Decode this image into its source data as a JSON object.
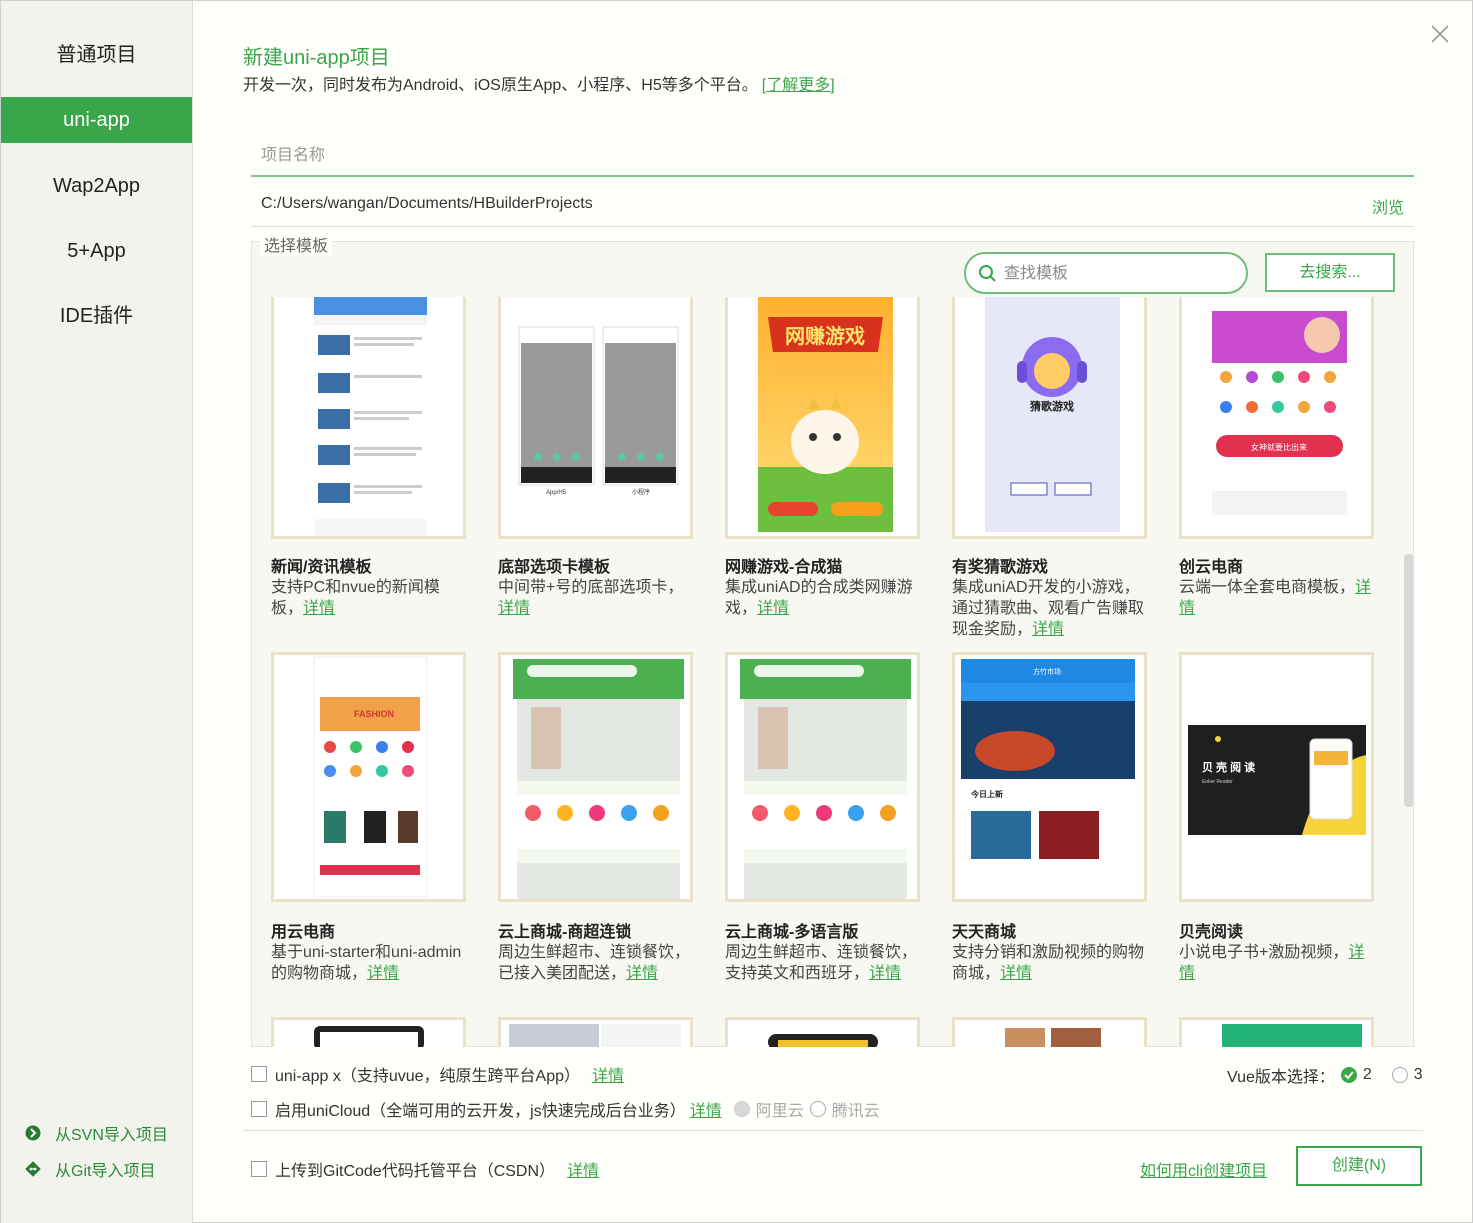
{
  "sidebar": {
    "items": [
      {
        "label": "普通项目"
      },
      {
        "label": "uni-app"
      },
      {
        "label": "Wap2App"
      },
      {
        "label": "5+App"
      },
      {
        "label": "IDE插件"
      }
    ],
    "svn_import": "从SVN导入项目",
    "git_import": "从Git导入项目"
  },
  "header": {
    "title": "新建uni-app项目",
    "subtitle": "开发一次，同时发布为Android、iOS原生App、小程序、H5等多个平台。",
    "learn_more": "[了解更多]"
  },
  "form": {
    "name_placeholder": "项目名称",
    "path": "C:/Users/wangan/Documents/HBuilderProjects",
    "browse": "浏览"
  },
  "templates": {
    "legend": "选择模板",
    "search_placeholder": "查找模板",
    "search_button": "去搜索...",
    "detail_link": "详情",
    "cards": [
      {
        "title": "新闻/资讯模板",
        "desc": "支持PC和nvue的新闻模板，"
      },
      {
        "title": "底部选项卡模板",
        "desc": "中间带+号的底部选项卡，"
      },
      {
        "title": "网赚游戏-合成猫",
        "desc": "集成uniAD的合成类网赚游戏，"
      },
      {
        "title": "有奖猜歌游戏",
        "desc": "集成uniAD开发的小游戏，通过猜歌曲、观看广告赚取现金奖励，"
      },
      {
        "title": "创云电商",
        "desc": "云端一体全套电商模板，"
      },
      {
        "title": "用云电商",
        "desc": "基于uni-starter和uni-admin的购物商城，"
      },
      {
        "title": "云上商城-商超连锁",
        "desc": "周边生鲜超市、连锁餐饮，已接入美团配送，"
      },
      {
        "title": "云上商城-多语言版",
        "desc": "周边生鲜超市、连锁餐饮，支持英文和西班牙，"
      },
      {
        "title": "天天商城",
        "desc": "支持分销和激励视频的购物商城，"
      },
      {
        "title": "贝壳阅读",
        "desc": "小说电子书+激励视频，"
      }
    ],
    "thumb_text": {
      "game_title": "网赚游戏",
      "guess_title": "猜歌游戏",
      "reader_title": "贝 壳 阅 读",
      "reader_sub": "Enker Reader",
      "shop_sale": "女神就要比出来",
      "tt_market": "方竹市场",
      "tt_new": "今日上新",
      "fashion": "FASHION",
      "app_h5": "App/H5",
      "mini": "小程序"
    }
  },
  "options": {
    "unix_label": "uni-app x（支持uvue，纯原生跨平台App）",
    "unicloud_label": "启用uniCloud（全端可用的云开发，js快速完成后台业务）",
    "aliyun": "阿里云",
    "tencent": "腾讯云",
    "vue_label": "Vue版本选择：",
    "vue2": "2",
    "vue3": "3",
    "gitcode_label": "上传到GitCode代码托管平台（CSDN）",
    "details": "详情"
  },
  "footer": {
    "cli_link": "如何用cli创建项目",
    "create": "创建(N)"
  },
  "colors": {
    "accent": "#3aa64a",
    "card_border": "#e9e1c8"
  }
}
